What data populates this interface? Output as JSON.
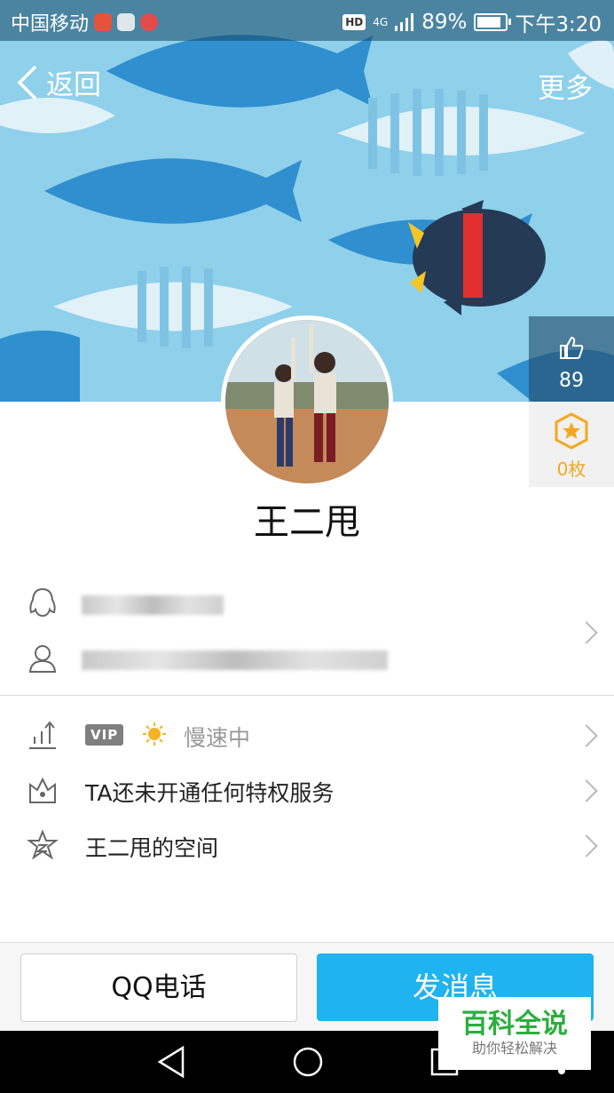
{
  "status_bar": {
    "carrier": "中国移动",
    "network": "4G",
    "battery": "89%",
    "time": "下午3:20"
  },
  "header": {
    "back_label": "返回",
    "more_label": "更多"
  },
  "side": {
    "like_count": "89",
    "medal_count": "0枚"
  },
  "profile": {
    "nickname": "王二甩"
  },
  "info_rows": {
    "vip_badge": "VIP",
    "speed_status": "慢速中",
    "privilege_text": "TA还未开通任何特权服务",
    "qzone_text": "王二甩的空间"
  },
  "actions": {
    "call_label": "QQ电话",
    "message_label": "发消息"
  },
  "watermark": {
    "title": "百科全说",
    "subtitle": "助你轻松解决"
  },
  "colors": {
    "accent": "#1fb3ef",
    "cover_bg": "#8ccfe9",
    "medal": "#f3a821"
  }
}
